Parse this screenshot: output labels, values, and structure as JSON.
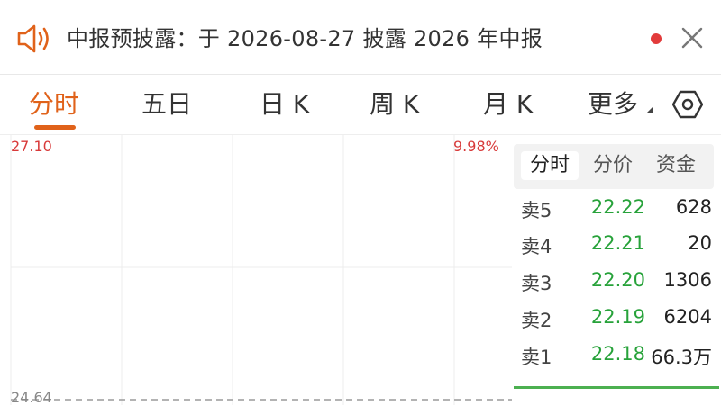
{
  "notice": {
    "text": "中报预披露：于 2026-08-27 披露 2026 年中报",
    "icons": {
      "speaker": "speaker-icon",
      "close": "close-icon"
    },
    "unread_color": "#e23b3b"
  },
  "tabs": [
    {
      "label": "分时",
      "active": true
    },
    {
      "label": "五日",
      "active": false
    },
    {
      "label": "日 K",
      "active": false
    },
    {
      "label": "周 K",
      "active": false
    },
    {
      "label": "月 K",
      "active": false
    },
    {
      "label": "更多",
      "active": false
    }
  ],
  "accent_color": "#e0621a",
  "chart": {
    "high_price": "27.10",
    "high_pct": "9.98%",
    "low_price": "24.64"
  },
  "order_panel": {
    "tabs": [
      {
        "label": "分时",
        "active": true
      },
      {
        "label": "分价",
        "active": false
      },
      {
        "label": "资金",
        "active": false
      }
    ],
    "asks": [
      {
        "label": "卖5",
        "price": "22.22",
        "volume": "628"
      },
      {
        "label": "卖4",
        "price": "22.21",
        "volume": "20"
      },
      {
        "label": "卖3",
        "price": "22.20",
        "volume": "1306"
      },
      {
        "label": "卖2",
        "price": "22.19",
        "volume": "6204"
      },
      {
        "label": "卖1",
        "price": "22.18",
        "volume": "66.3万"
      }
    ],
    "ask_price_color": "#27a23a",
    "divider_color": "#4cb050"
  }
}
